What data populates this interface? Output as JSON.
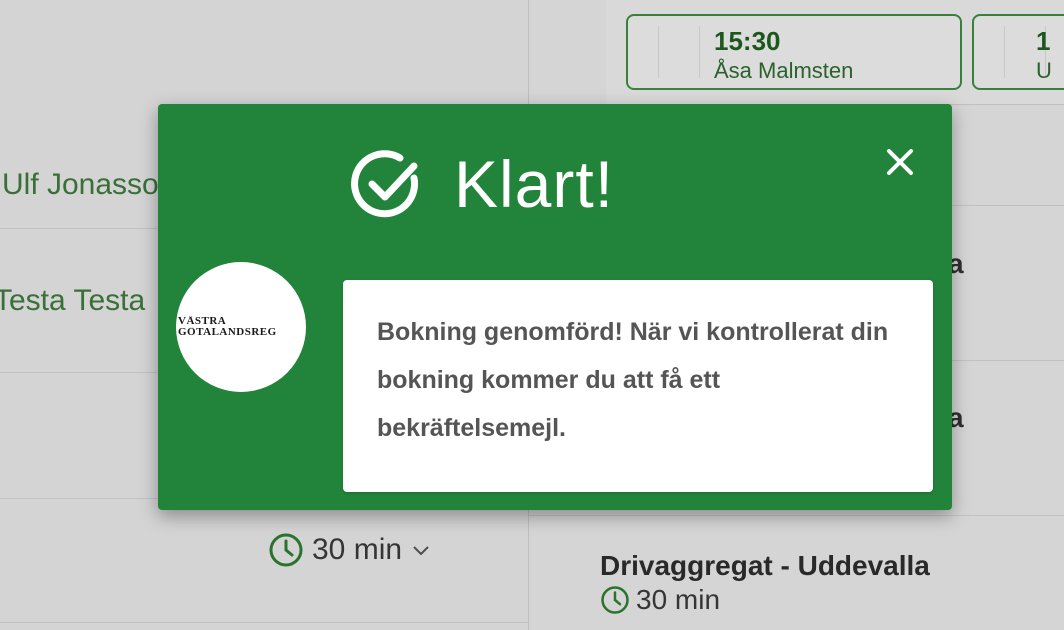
{
  "background": {
    "names": [
      "Ulf Jonasson",
      "Testa Testa"
    ],
    "slots": [
      {
        "time": "15:30",
        "who": "Åsa Malmsten"
      },
      {
        "time": "1",
        "who": "U"
      }
    ],
    "duration_label": "30 min",
    "service": {
      "title": "Drivaggregat - Uddevalla",
      "duration": "30 min"
    },
    "peek_letters": [
      "a",
      "a"
    ]
  },
  "modal": {
    "title": "Klart!",
    "logo_lines": [
      "VÄSTRA",
      "GÖTALANDSREG"
    ],
    "message": "Bokning genomförd! När vi kontrollerat din bokning kommer du att få ett bekräftelsemejl.",
    "colors": {
      "accent": "#22843a",
      "text": "#555555"
    }
  }
}
